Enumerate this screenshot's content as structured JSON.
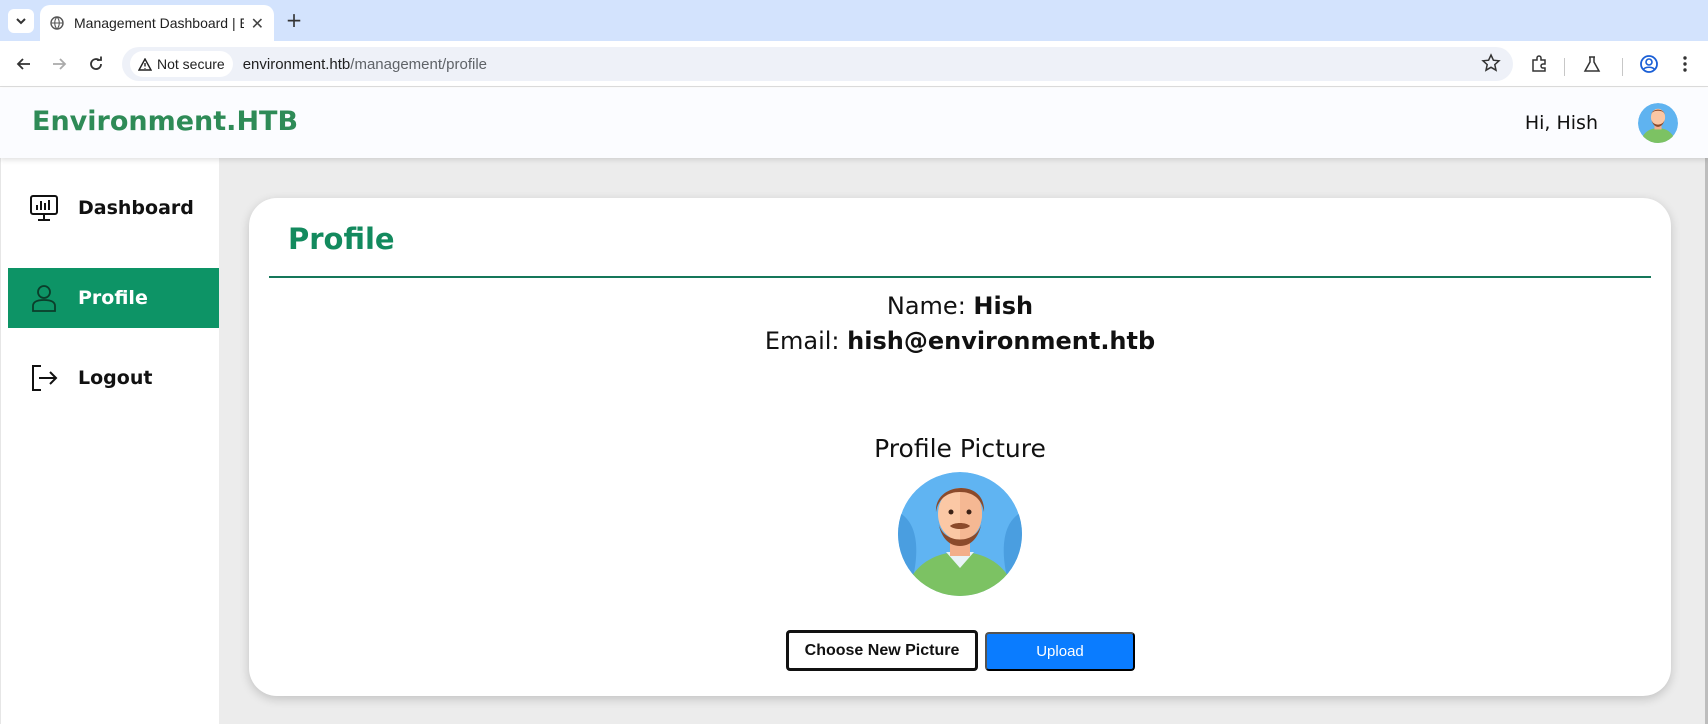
{
  "browser": {
    "tab_title": "Management Dashboard | Environment.HTB",
    "security_label": "Not secure",
    "url_host": "environment.htb",
    "url_path": "/management/profile"
  },
  "header": {
    "brand": "Environment.HTB",
    "greeting": "Hi, Hish"
  },
  "sidebar": {
    "items": [
      {
        "label": "Dashboard",
        "icon": "dashboard-monitor-icon"
      },
      {
        "label": "Profile",
        "icon": "user-icon",
        "active": true
      },
      {
        "label": "Logout",
        "icon": "logout-icon"
      }
    ]
  },
  "profile": {
    "title": "Profile",
    "name_label": "Name:",
    "name_value": "Hish",
    "email_label": "Email:",
    "email_value": "hish@environment.htb",
    "picture_title": "Profile Picture",
    "choose_button": "Choose New Picture",
    "upload_button": "Upload"
  },
  "colors": {
    "brand_green": "#2e8b57",
    "active_green": "#0d9466",
    "upload_blue": "#0a7cff"
  }
}
